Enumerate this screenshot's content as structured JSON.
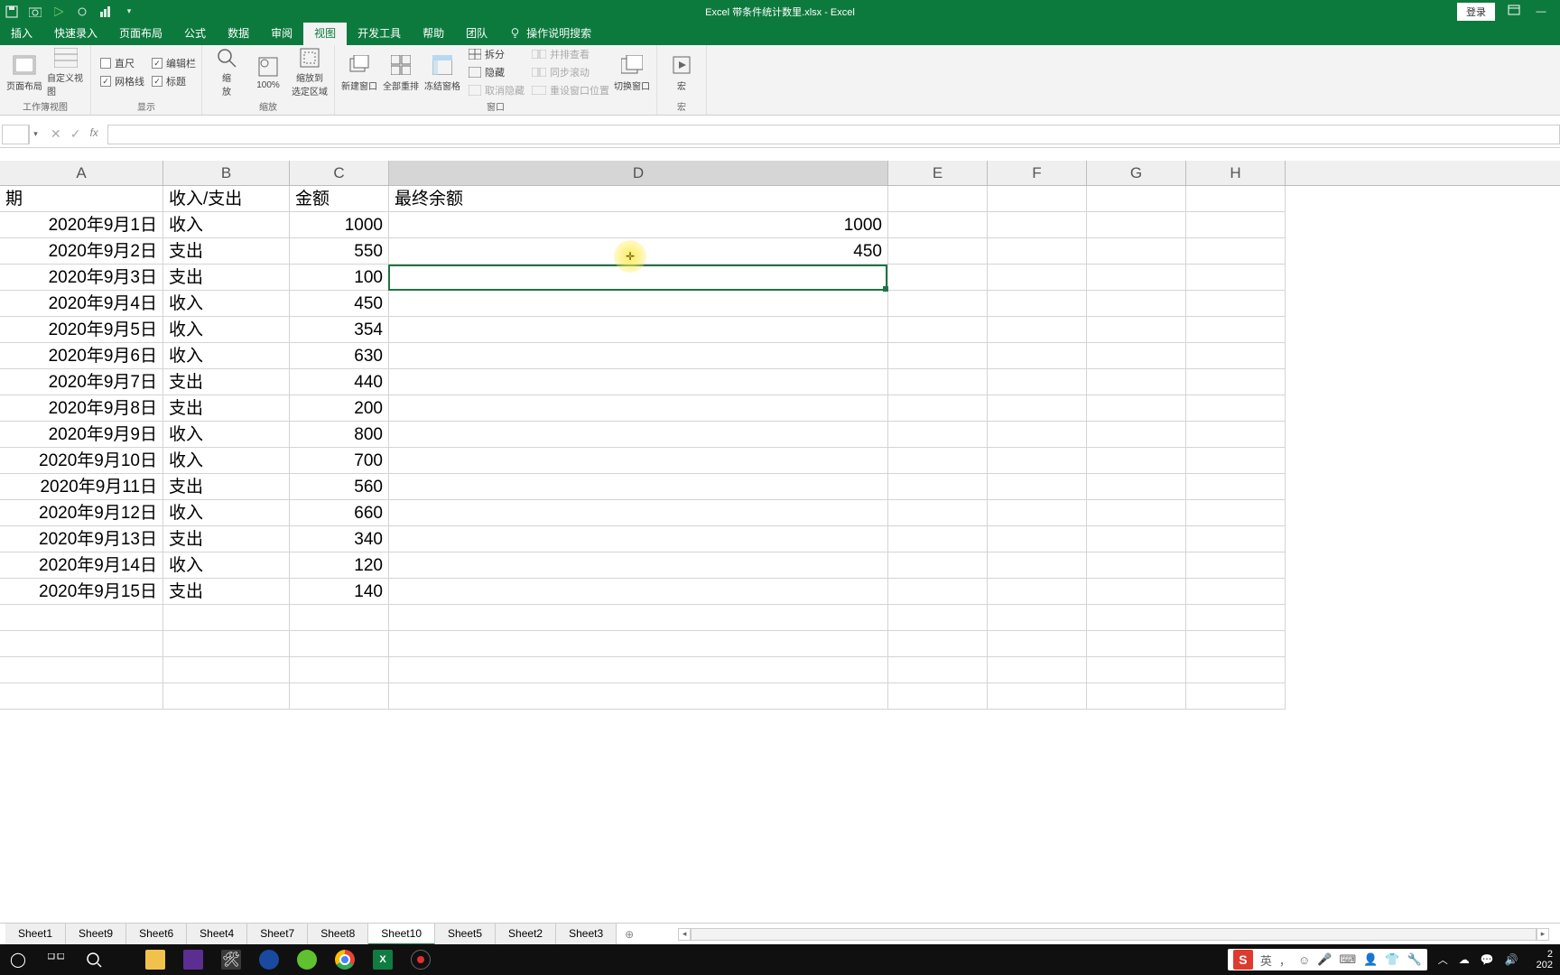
{
  "titlebar": {
    "doc_title": "Excel 带条件统计数里.xlsx  -  Excel",
    "login": "登录"
  },
  "tabs": {
    "insert": "插入",
    "quick": "快速录入",
    "page_layout": "页面布局",
    "formulas": "公式",
    "data": "数据",
    "review": "审阅",
    "view": "视图",
    "dev": "开发工具",
    "help": "帮助",
    "team": "团队",
    "search": "操作说明搜索"
  },
  "ribbon": {
    "group_views_label": "工作簿视图",
    "page_layout_btn": "页面布局",
    "custom_views_btn": "自定义视图",
    "group_show_label": "显示",
    "ruler": "直尺",
    "formula_bar": "编辑栏",
    "gridlines": "网格线",
    "headings": "标题",
    "group_zoom_label": "缩放",
    "zoom": "缩\n放",
    "zoom_100": "100%",
    "zoom_sel": "缩放到\n选定区域",
    "group_window_label": "窗口",
    "new_window": "新建窗口",
    "arrange_all": "全部重排",
    "freeze": "冻结窗格",
    "split": "拆分",
    "hide": "隐藏",
    "unhide": "取消隐藏",
    "side_by_side": "并排查看",
    "sync_scroll": "同步滚动",
    "reset_pos": "重设窗口位置",
    "switch_windows": "切换窗口",
    "macros": "宏",
    "group_macros_label": "宏"
  },
  "formula_bar": {
    "value": ""
  },
  "columns": [
    "A",
    "B",
    "C",
    "D",
    "E",
    "F",
    "G",
    "H"
  ],
  "header_row": {
    "a": "期",
    "b": "收入/支出",
    "c": "金额",
    "d": "最终余额"
  },
  "rows": [
    {
      "a": "2020年9月1日",
      "b": "收入",
      "c": "1000",
      "d": "1000"
    },
    {
      "a": "2020年9月2日",
      "b": "支出",
      "c": "550",
      "d": "450"
    },
    {
      "a": "2020年9月3日",
      "b": "支出",
      "c": "100",
      "d": ""
    },
    {
      "a": "2020年9月4日",
      "b": "收入",
      "c": "450",
      "d": ""
    },
    {
      "a": "2020年9月5日",
      "b": "收入",
      "c": "354",
      "d": ""
    },
    {
      "a": "2020年9月6日",
      "b": "收入",
      "c": "630",
      "d": ""
    },
    {
      "a": "2020年9月7日",
      "b": "支出",
      "c": "440",
      "d": ""
    },
    {
      "a": "2020年9月8日",
      "b": "支出",
      "c": "200",
      "d": ""
    },
    {
      "a": "2020年9月9日",
      "b": "收入",
      "c": "800",
      "d": ""
    },
    {
      "a": "2020年9月10日",
      "b": "收入",
      "c": "700",
      "d": ""
    },
    {
      "a": "2020年9月11日",
      "b": "支出",
      "c": "560",
      "d": ""
    },
    {
      "a": "2020年9月12日",
      "b": "收入",
      "c": "660",
      "d": ""
    },
    {
      "a": "2020年9月13日",
      "b": "支出",
      "c": "340",
      "d": ""
    },
    {
      "a": "2020年9月14日",
      "b": "收入",
      "c": "120",
      "d": ""
    },
    {
      "a": "2020年9月15日",
      "b": "支出",
      "c": "140",
      "d": ""
    }
  ],
  "sheets": [
    "Sheet1",
    "Sheet9",
    "Sheet6",
    "Sheet4",
    "Sheet7",
    "Sheet8",
    "Sheet10",
    "Sheet5",
    "Sheet2",
    "Sheet3"
  ],
  "active_sheet": "Sheet10",
  "selected_cell": {
    "col": "D",
    "row_index": 3
  },
  "ime": {
    "lang": "英"
  },
  "clock": {
    "time": "2",
    "date": "202"
  }
}
